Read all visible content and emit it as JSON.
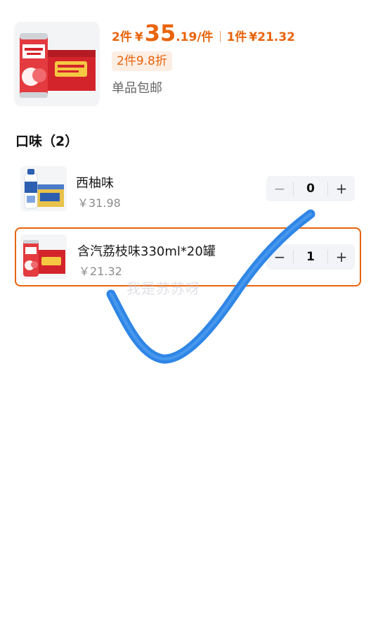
{
  "product": {
    "qty_label": "2件",
    "currency": "¥",
    "price_int": "35",
    "price_dec": ".19",
    "per_unit": "/件",
    "single_label": "1件",
    "single_price": "¥21.32",
    "discount": "2件9.8折",
    "shipping": "单品包邮"
  },
  "section": {
    "title": "口味（2）"
  },
  "options": [
    {
      "name": "西柚味",
      "price": "￥31.98",
      "quantity": "0",
      "selected": false
    },
    {
      "name": "含汽荔枝味330ml*20罐",
      "price": "￥21.32",
      "quantity": "1",
      "selected": true
    }
  ],
  "stepper": {
    "minus": "−",
    "plus": "+"
  },
  "watermark": "我是苏苏呀",
  "colors": {
    "accent": "#e8640c",
    "check": "#2f86e6"
  }
}
